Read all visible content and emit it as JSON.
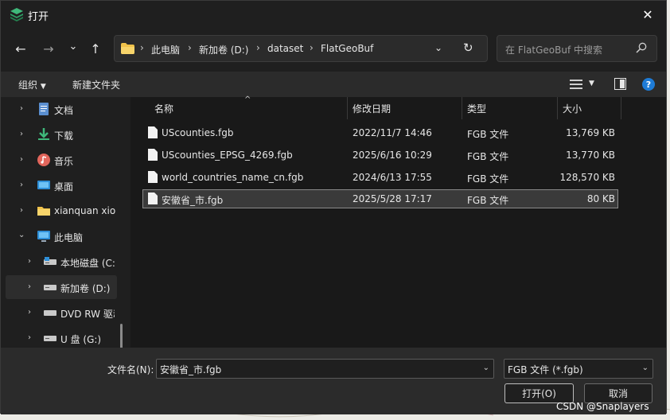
{
  "window": {
    "title": "打开",
    "close_glyph": "✕"
  },
  "nav": {
    "back": "←",
    "forward": "→",
    "recent": "⌄",
    "up": "↑"
  },
  "breadcrumb": {
    "items": [
      "此电脑",
      "新加卷 (D:)",
      "dataset",
      "FlatGeoBuf"
    ],
    "separator": "›"
  },
  "search": {
    "placeholder": "在 FlatGeoBuf 中搜索"
  },
  "toolbar": {
    "organize": "组织",
    "new_folder": "新建文件夹"
  },
  "sidebar": {
    "items": [
      {
        "label": "文档",
        "icon": "documents-icon",
        "indent": 1
      },
      {
        "label": "下载",
        "icon": "downloads-icon",
        "indent": 1
      },
      {
        "label": "音乐",
        "icon": "music-icon",
        "indent": 1
      },
      {
        "label": "桌面",
        "icon": "desktop-icon",
        "indent": 1
      },
      {
        "label": "xianquan xiong",
        "icon": "folder-icon",
        "indent": 1
      },
      {
        "label": "此电脑",
        "icon": "this-pc-icon",
        "indent": 1,
        "expanded": true
      },
      {
        "label": "本地磁盘 (C:)",
        "icon": "drive-icon",
        "indent": 2
      },
      {
        "label": "新加卷 (D:)",
        "icon": "drive-icon",
        "indent": 2,
        "selected": true
      },
      {
        "label": "DVD RW 驱动器",
        "icon": "dvd-icon",
        "indent": 2
      },
      {
        "label": "U 盘 (G:)",
        "icon": "usb-drive-icon",
        "indent": 2
      }
    ]
  },
  "columns": {
    "name": "名称",
    "modified": "修改日期",
    "type": "类型",
    "size": "大小"
  },
  "files": [
    {
      "name": "UScounties.fgb",
      "modified": "2022/11/7 14:46",
      "type": "FGB 文件",
      "size": "13,769 KB"
    },
    {
      "name": "UScounties_EPSG_4269.fgb",
      "modified": "2025/6/16 10:29",
      "type": "FGB 文件",
      "size": "13,770 KB"
    },
    {
      "name": "world_countries_name_cn.fgb",
      "modified": "2024/6/13 17:55",
      "type": "FGB 文件",
      "size": "128,570 KB"
    },
    {
      "name": "安徽省_市.fgb",
      "modified": "2025/5/28 17:17",
      "type": "FGB 文件",
      "size": "80 KB",
      "selected": true
    }
  ],
  "footer": {
    "filename_label": "文件名(N):",
    "filename_value": "安徽省_市.fgb",
    "filetype_value": "FGB 文件 (*.fgb)",
    "open_label": "打开(O)",
    "cancel_label": "取消"
  },
  "watermark": "CSDN @Snaplayers",
  "colors": {
    "dialog_bg": "#1f1f1f",
    "bar_bg": "#2b2b2b",
    "list_bg": "#191919",
    "accent": "#0078d4"
  }
}
